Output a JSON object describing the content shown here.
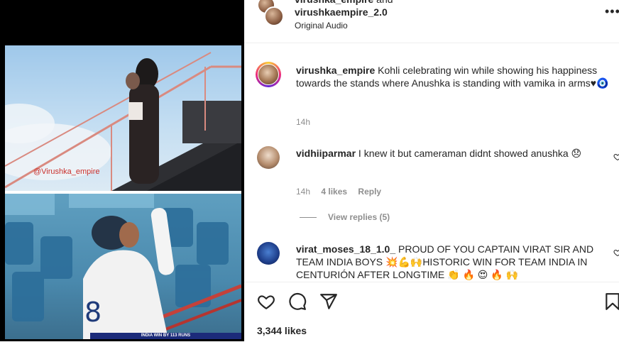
{
  "header": {
    "line1_user": "virushka_empire",
    "line1_conj": " and",
    "user2": "virushkaempire_2.0",
    "audio": "Original Audio",
    "more_icon": "more-horizontal-icon"
  },
  "media": {
    "watermark": "@Virushka_empire",
    "score_strip": "INDIA WIN BY 113 RUNS"
  },
  "caption": {
    "user": "virushka_empire",
    "text": " Kohli celebrating win while showing his happiness towards the stands where Anushka is standing with vamika in arms♥🧿",
    "time": "14h"
  },
  "comments": [
    {
      "user": "vidhiiparmar",
      "text": " I knew it but cameraman didnt showed anushka 😞",
      "time": "14h",
      "likes": "4 likes",
      "reply": "Reply"
    },
    {
      "user": "virat_moses_18_1.0_",
      "text": " PROUD OF YOU CAPTAIN VIRAT SIR AND TEAM INDIA BOYS 💥💪🙌HISTORIC WIN FOR TEAM INDIA IN CENTURIÓN AFTER LONGTIME 👏 🔥 😍 🔥 🙌"
    }
  ],
  "view_replies": "View replies (5)",
  "likes_count": "3,344 likes",
  "icons": {
    "like": "heart-icon",
    "comment": "comment-icon",
    "share": "paper-plane-icon",
    "save": "bookmark-icon"
  },
  "colors": {
    "text": "#262626",
    "muted": "#8e8e8e",
    "divider": "#efefef"
  }
}
